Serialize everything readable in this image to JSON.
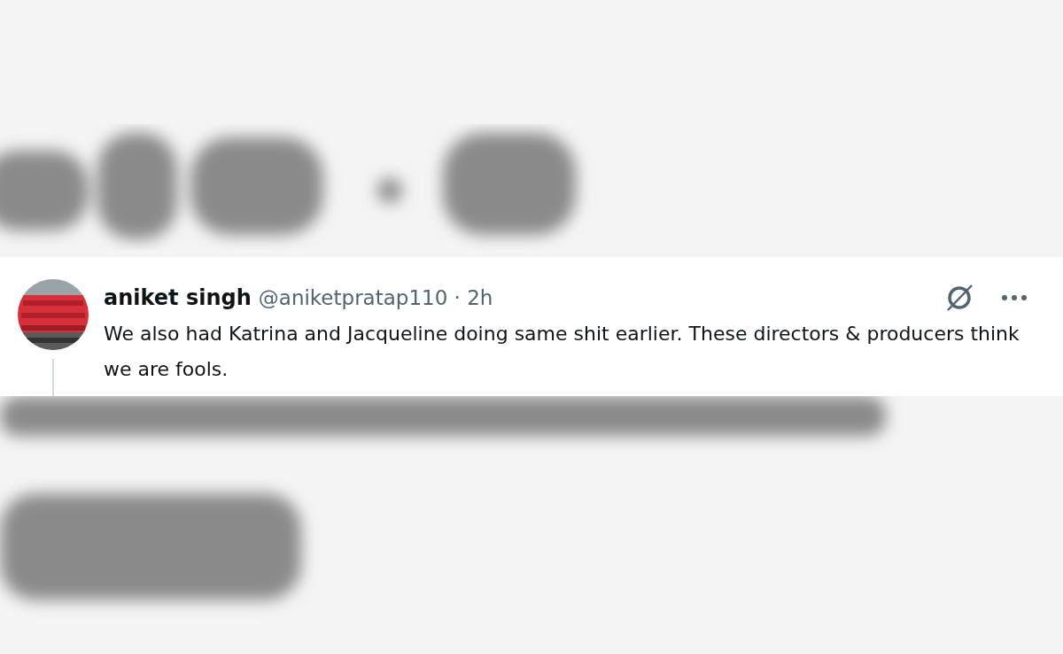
{
  "tweet": {
    "author_name": "aniket singh",
    "handle_time": "@aniketpratap110 · 2h",
    "text": "We also had Katrina and Jacqueline doing same shit earlier. These directors & producers think we are fools."
  }
}
